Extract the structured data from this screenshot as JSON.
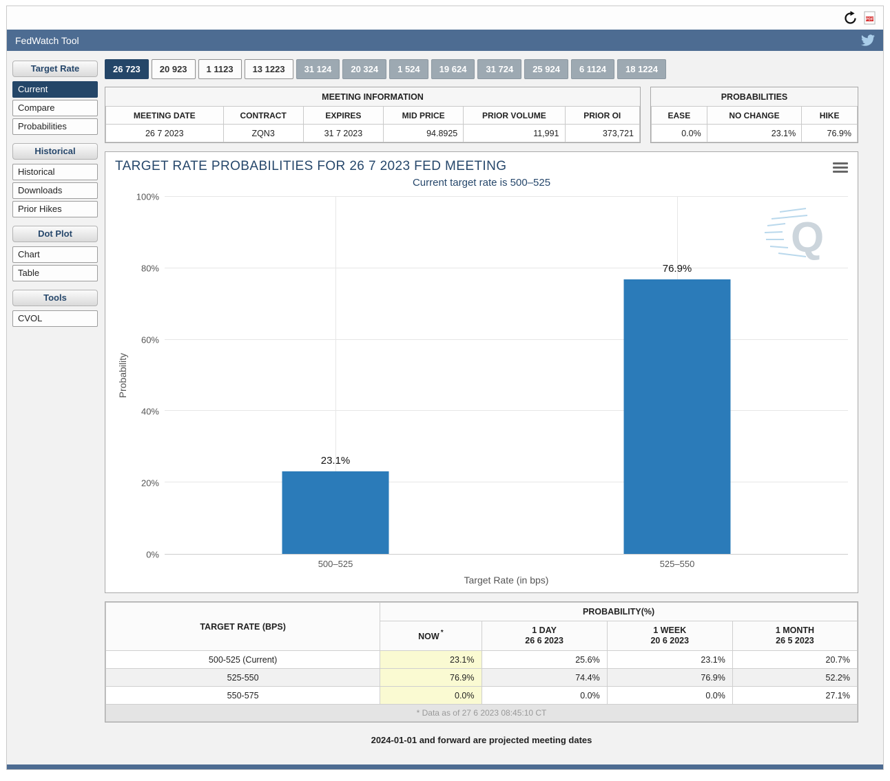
{
  "header": {
    "title": "FedWatch Tool"
  },
  "sidebar": {
    "sections": [
      {
        "header": "Target Rate",
        "items": [
          {
            "label": "Current",
            "selected": true
          },
          {
            "label": "Compare"
          },
          {
            "label": "Probabilities"
          }
        ]
      },
      {
        "header": "Historical",
        "items": [
          {
            "label": "Historical"
          },
          {
            "label": "Downloads"
          },
          {
            "label": "Prior Hikes"
          }
        ]
      },
      {
        "header": "Dot Plot",
        "items": [
          {
            "label": "Chart"
          },
          {
            "label": "Table"
          }
        ]
      },
      {
        "header": "Tools",
        "items": [
          {
            "label": "CVOL"
          }
        ]
      }
    ]
  },
  "tabs": [
    {
      "label": "26 723",
      "state": "selected"
    },
    {
      "label": "20 923",
      "state": "open"
    },
    {
      "label": "1 1123",
      "state": "open"
    },
    {
      "label": "13 1223",
      "state": "open"
    },
    {
      "label": "31 124",
      "state": "future"
    },
    {
      "label": "20 324",
      "state": "future"
    },
    {
      "label": "1 524",
      "state": "future"
    },
    {
      "label": "19 624",
      "state": "future"
    },
    {
      "label": "31 724",
      "state": "future"
    },
    {
      "label": "25 924",
      "state": "future"
    },
    {
      "label": "6 1124",
      "state": "future"
    },
    {
      "label": "18 1224",
      "state": "future"
    }
  ],
  "meeting_info": {
    "title": "MEETING INFORMATION",
    "headers": [
      "MEETING DATE",
      "CONTRACT",
      "EXPIRES",
      "MID PRICE",
      "PRIOR VOLUME",
      "PRIOR OI"
    ],
    "values": [
      "26 7 2023",
      "ZQN3",
      "31 7 2023",
      "94.8925",
      "11,991",
      "373,721"
    ]
  },
  "probabilities_panel": {
    "title": "PROBABILITIES",
    "headers": [
      "EASE",
      "NO CHANGE",
      "HIKE"
    ],
    "values": [
      "0.0%",
      "23.1%",
      "76.9%"
    ]
  },
  "chart_data": {
    "type": "bar",
    "title": "TARGET RATE PROBABILITIES FOR 26 7 2023 FED MEETING",
    "subtitle": "Current target rate is 500–525",
    "categories": [
      "500–525",
      "525–550"
    ],
    "values": [
      23.1,
      76.9
    ],
    "value_labels": [
      "23.1%",
      "76.9%"
    ],
    "xlabel": "Target Rate (in bps)",
    "ylabel": "Probability",
    "ylim": [
      0,
      100
    ],
    "yticks": [
      "0%",
      "20%",
      "40%",
      "60%",
      "80%",
      "100%"
    ],
    "grid": true,
    "legend": "none",
    "bar_color": "#2b7bb9",
    "watermark": "Q"
  },
  "prob_table": {
    "col1_header": "TARGET RATE (BPS)",
    "group_header": "PROBABILITY(%)",
    "sub_headers": [
      {
        "line1": "NOW",
        "sup": "*",
        "line2": ""
      },
      {
        "line1": "1 DAY",
        "line2": "26 6 2023"
      },
      {
        "line1": "1 WEEK",
        "line2": "20 6 2023"
      },
      {
        "line1": "1 MONTH",
        "line2": "26 5 2023"
      }
    ],
    "rows": [
      {
        "rate": "500-525 (Current)",
        "now": "23.1%",
        "day": "25.6%",
        "week": "23.1%",
        "month": "20.7%"
      },
      {
        "rate": "525-550",
        "now": "76.9%",
        "day": "74.4%",
        "week": "76.9%",
        "month": "52.2%"
      },
      {
        "rate": "550-575",
        "now": "0.0%",
        "day": "0.0%",
        "week": "0.0%",
        "month": "27.1%"
      }
    ],
    "footnote": "* Data as of 27 6 2023 08:45:10 CT"
  },
  "bottom_note": "2024-01-01 and forward are projected meeting dates",
  "colors": {
    "header_bar": "#4d6c92",
    "selected_navy": "#244668",
    "future_tab_gray": "#9da9b2",
    "bar_blue": "#2b7bb9",
    "now_cell_yellow": "#fafad2"
  }
}
